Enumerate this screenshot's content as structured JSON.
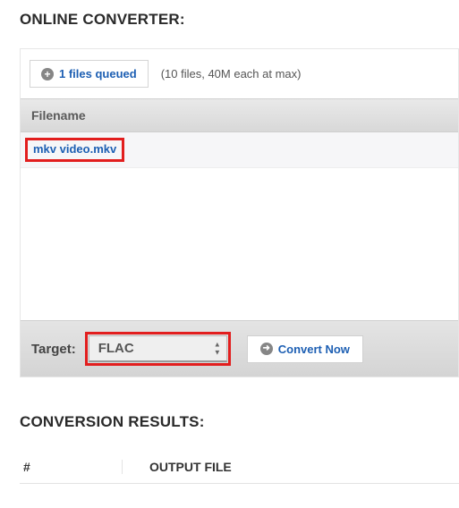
{
  "converter": {
    "title": "ONLINE CONVERTER:",
    "queue_button": "1 files queued",
    "limit_text": "(10 files, 40M each at max)",
    "filename_header": "Filename",
    "files": [
      "mkv video.mkv"
    ],
    "target_label": "Target:",
    "format_value": "FLAC",
    "convert_button": "Convert Now"
  },
  "results": {
    "title": "CONVERSION RESULTS:",
    "col_num": "#",
    "col_output": "OUTPUT FILE"
  }
}
